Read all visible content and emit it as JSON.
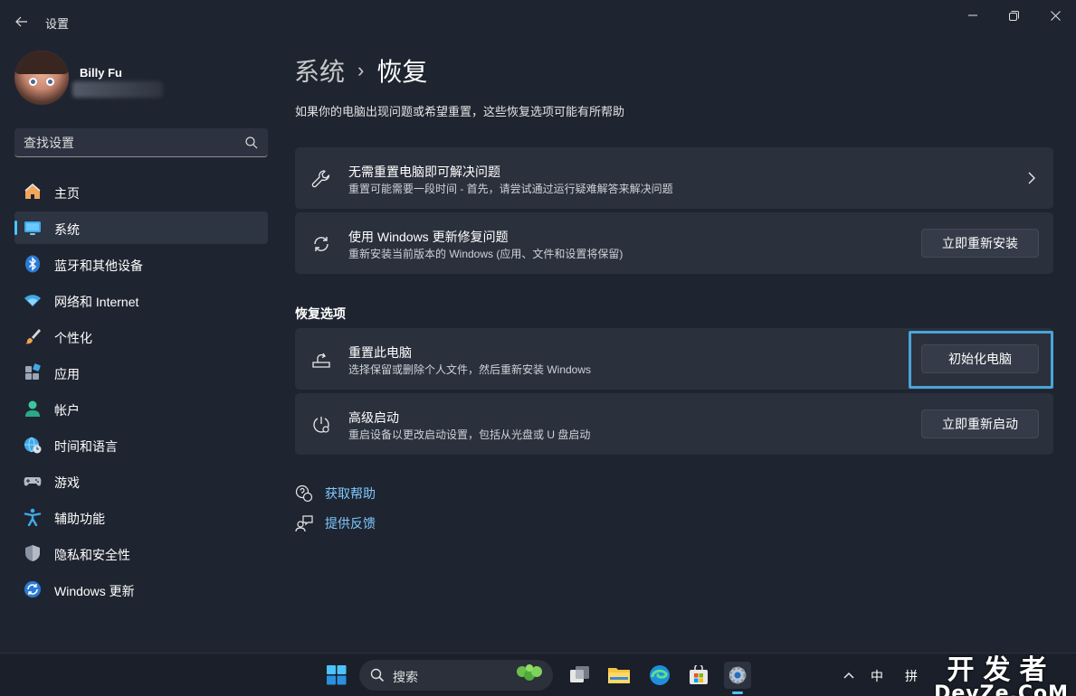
{
  "window": {
    "title": "设置",
    "back_icon": "arrow-left-icon",
    "controls": [
      "minimize-icon",
      "restore-icon",
      "close-icon"
    ]
  },
  "user": {
    "name": "Billy Fu"
  },
  "search": {
    "placeholder": "查找设置"
  },
  "sidebar": {
    "items": [
      {
        "label": "主页",
        "icon": "home-icon",
        "active": false
      },
      {
        "label": "系统",
        "icon": "monitor-icon",
        "active": true
      },
      {
        "label": "蓝牙和其他设备",
        "icon": "bluetooth-icon",
        "active": false
      },
      {
        "label": "网络和 Internet",
        "icon": "wifi-icon",
        "active": false
      },
      {
        "label": "个性化",
        "icon": "brush-icon",
        "active": false
      },
      {
        "label": "应用",
        "icon": "apps-icon",
        "active": false
      },
      {
        "label": "帐户",
        "icon": "person-icon",
        "active": false
      },
      {
        "label": "时间和语言",
        "icon": "globe-clock-icon",
        "active": false
      },
      {
        "label": "游戏",
        "icon": "gamepad-icon",
        "active": false
      },
      {
        "label": "辅助功能",
        "icon": "accessibility-icon",
        "active": false
      },
      {
        "label": "隐私和安全性",
        "icon": "shield-icon",
        "active": false
      },
      {
        "label": "Windows 更新",
        "icon": "update-icon",
        "active": false
      }
    ]
  },
  "main": {
    "breadcrumb_parent": "系统",
    "breadcrumb_current": "恢复",
    "description": "如果你的电脑出现问题或希望重置，这些恢复选项可能有所帮助",
    "cards": [
      {
        "title": "无需重置电脑即可解决问题",
        "subtitle": "重置可能需要一段时间 - 首先，请尝试通过运行疑难解答来解决问题",
        "icon": "wrench-icon"
      },
      {
        "title": "使用 Windows 更新修复问题",
        "subtitle": "重新安装当前版本的 Windows (应用、文件和设置将保留)",
        "button": "立即重新安装",
        "icon": "sync-icon"
      }
    ],
    "section_title": "恢复选项",
    "options": [
      {
        "title": "重置此电脑",
        "subtitle": "选择保留或删除个人文件，然后重新安装 Windows",
        "button": "初始化电脑",
        "icon": "reset-pc-icon",
        "focused": true
      },
      {
        "title": "高级启动",
        "subtitle": "重启设备以更改启动设置，包括从光盘或 U 盘启动",
        "button": "立即重新启动",
        "icon": "advanced-startup-icon"
      }
    ],
    "links": [
      {
        "label": "获取帮助",
        "icon": "help-chat-icon"
      },
      {
        "label": "提供反馈",
        "icon": "feedback-icon"
      }
    ]
  },
  "taskbar": {
    "search_label": "搜索",
    "tray_ime_1": "中",
    "tray_ime_2": "拼",
    "watermark_cn": "开发者",
    "watermark_en": "DevZe.CoM"
  },
  "colors": {
    "accent": "#4cc2ff",
    "link": "#7fc8ff",
    "focus": "#4aa4d8",
    "background": "#1f2530",
    "card": "#2a303c"
  }
}
